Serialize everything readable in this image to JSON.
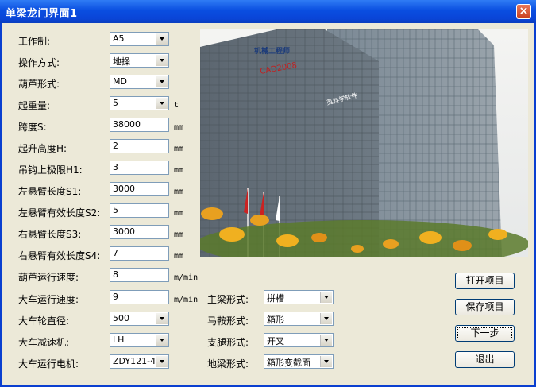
{
  "window": {
    "title": "单梁龙门界面1",
    "close_label": "×"
  },
  "photo": {
    "logo_text": "机械工程师",
    "logo_sub": "CAD2008",
    "sign_text": "英科学软件"
  },
  "left_fields": [
    {
      "label": "工作制:",
      "type": "combo",
      "value": "A5",
      "unit": ""
    },
    {
      "label": "操作方式:",
      "type": "combo",
      "value": "地操",
      "unit": ""
    },
    {
      "label": "葫芦形式:",
      "type": "combo",
      "value": "MD",
      "unit": ""
    },
    {
      "label": "起重量:",
      "type": "combo",
      "value": "5",
      "unit": "t"
    },
    {
      "label": "跨度S:",
      "type": "edit",
      "value": "38000",
      "unit": "mm"
    },
    {
      "label": "起升高度H:",
      "type": "edit",
      "value": "2",
      "unit": "mm"
    },
    {
      "label": "吊钩上极限H1:",
      "type": "edit",
      "value": "3",
      "unit": "mm"
    },
    {
      "label": "左悬臂长度S1:",
      "type": "edit",
      "value": "3000",
      "unit": "mm"
    },
    {
      "label": "左悬臂有效长度S2:",
      "type": "edit",
      "value": "5",
      "unit": "mm"
    },
    {
      "label": "右悬臂长度S3:",
      "type": "edit",
      "value": "3000",
      "unit": "mm"
    },
    {
      "label": "右悬臂有效长度S4:",
      "type": "edit",
      "value": "7",
      "unit": "mm"
    },
    {
      "label": "葫芦运行速度:",
      "type": "edit",
      "value": "8",
      "unit": "m/min"
    },
    {
      "label": "大车运行速度:",
      "type": "edit",
      "value": "9",
      "unit": "m/min"
    },
    {
      "label": "大车轮直径:",
      "type": "combo",
      "value": "500",
      "unit": ""
    },
    {
      "label": "大车减速机:",
      "type": "combo",
      "value": "LH",
      "unit": ""
    },
    {
      "label": "大车运行电机:",
      "type": "combo",
      "value": "ZDY121-4",
      "unit": ""
    }
  ],
  "right_fields": [
    {
      "label": "主梁形式:",
      "value": "拼槽"
    },
    {
      "label": "马鞍形式:",
      "value": "箱形"
    },
    {
      "label": "支腿形式:",
      "value": "开叉"
    },
    {
      "label": "地梁形式:",
      "value": "箱形变截面"
    }
  ],
  "buttons": {
    "open": "打开项目",
    "save": "保存项目",
    "next": "下一步",
    "exit": "退出"
  }
}
